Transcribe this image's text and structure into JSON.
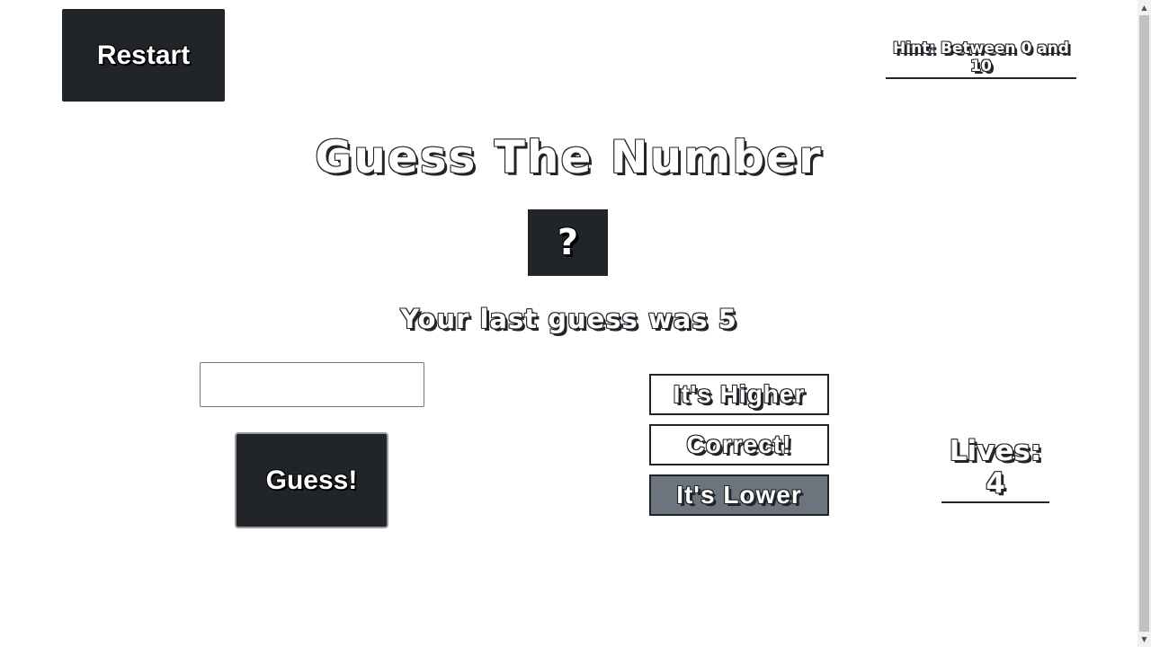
{
  "header": {
    "restart_label": "Restart",
    "hint_text": "Hint: Between 0 and 10"
  },
  "main": {
    "title": "Guess The Number",
    "mystery_number": "?",
    "last_guess_text": "Your last guess was 5",
    "guess_input": {
      "value": "",
      "placeholder": ""
    },
    "guess_button_label": "Guess!"
  },
  "feedback": {
    "higher_label": "It's Higher",
    "correct_label": "Correct!",
    "lower_label": "It's Lower"
  },
  "status": {
    "lives_text": "Lives: 4"
  },
  "colors": {
    "dark": "#212529",
    "selected_feedback": "#6c757d",
    "background": "#ffffff"
  },
  "icons": {
    "scroll_up": "triangle-up-icon",
    "scroll_down": "triangle-down-icon"
  }
}
